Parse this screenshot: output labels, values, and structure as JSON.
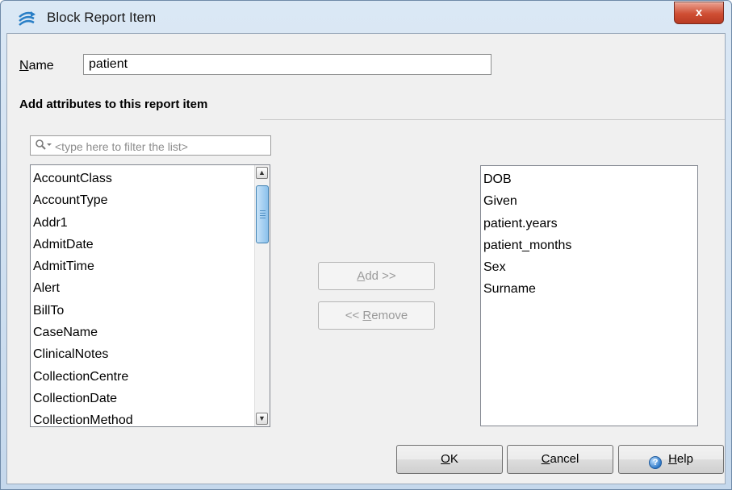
{
  "window": {
    "title": "Block Report Item",
    "close_glyph": "x"
  },
  "name_field": {
    "label_mnemonic": "N",
    "label_rest": "ame",
    "value": "patient"
  },
  "section_heading": "Add attributes to this report item",
  "filter": {
    "placeholder": "<type here to filter the list>"
  },
  "available_attributes": [
    "AccountClass",
    "AccountType",
    "Addr1",
    "AdmitDate",
    "AdmitTime",
    "Alert",
    "BillTo",
    "CaseName",
    "ClinicalNotes",
    "CollectionCentre",
    "CollectionDate",
    "CollectionMethod"
  ],
  "selected_attributes": [
    "DOB",
    "Given",
    "patient.years",
    "patient_months",
    "Sex",
    "Surname"
  ],
  "transfer_buttons": {
    "add_mnemonic": "A",
    "add_rest": "dd >>",
    "remove_prefix": "<< ",
    "remove_mnemonic": "R",
    "remove_rest": "emove"
  },
  "dialog_buttons": {
    "ok_mnemonic": "O",
    "ok_rest": "K",
    "cancel_mnemonic": "C",
    "cancel_rest": "ancel",
    "help_mnemonic": "H",
    "help_rest": "elp"
  },
  "icons": {
    "app": "wifi-swoosh-icon",
    "filter": "search-icon",
    "help": "help-icon",
    "scroll_up": "scroll-up-arrow-icon",
    "scroll_down": "scroll-down-arrow-icon"
  },
  "colors": {
    "title_bar": "#c5d8ec",
    "close_button": "#cf4e33",
    "scroll_thumb": "#a9d2f2"
  }
}
